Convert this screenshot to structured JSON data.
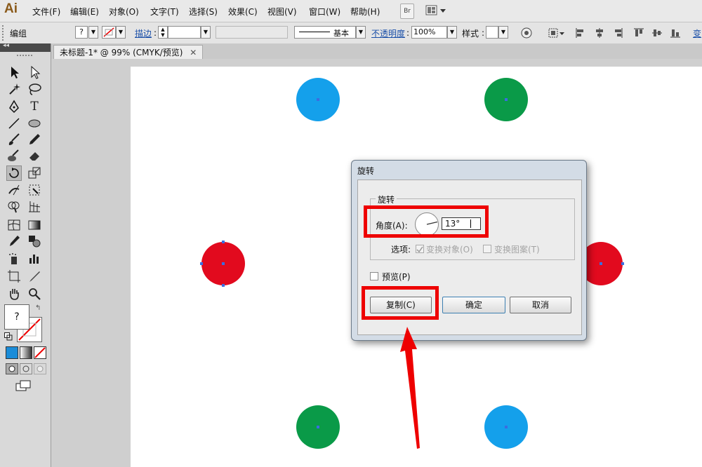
{
  "app": {
    "logo": "Ai"
  },
  "menu": {
    "items": [
      "文件(F)",
      "编辑(E)",
      "对象(O)",
      "文字(T)",
      "选择(S)",
      "效果(C)",
      "视图(V)",
      "窗口(W)",
      "帮助(H)"
    ],
    "bridge_button": "Br"
  },
  "control_bar": {
    "selection_label": "编组",
    "fill_value": "?",
    "stroke_label": "描边",
    "stroke_style": "基本",
    "opacity_label": "不透明度",
    "opacity_value": "100%",
    "style_label": "样式",
    "transform_link": "变"
  },
  "document_tab": {
    "title": "未标题-1* @ 99% (CMYK/预览)"
  },
  "toolbox": {
    "fill_stroke_label": "?"
  },
  "artboard": {
    "colors": {
      "blue": "#14a0eb",
      "green": "#0a9a48",
      "red": "#e20a1e"
    }
  },
  "rotate_dialog": {
    "title": "旋转",
    "group_title": "旋转",
    "angle_label": "角度(A):",
    "angle_value": "13°",
    "options_label": "选项:",
    "transform_objects": "变换对象(O)",
    "transform_patterns": "变换图案(T)",
    "preview_label": "预览(P)",
    "copy_button": "复制(C)",
    "ok_button": "确定",
    "cancel_button": "取消"
  },
  "colors": {
    "highlight": "#ee0000",
    "link": "#1a4fa8"
  }
}
